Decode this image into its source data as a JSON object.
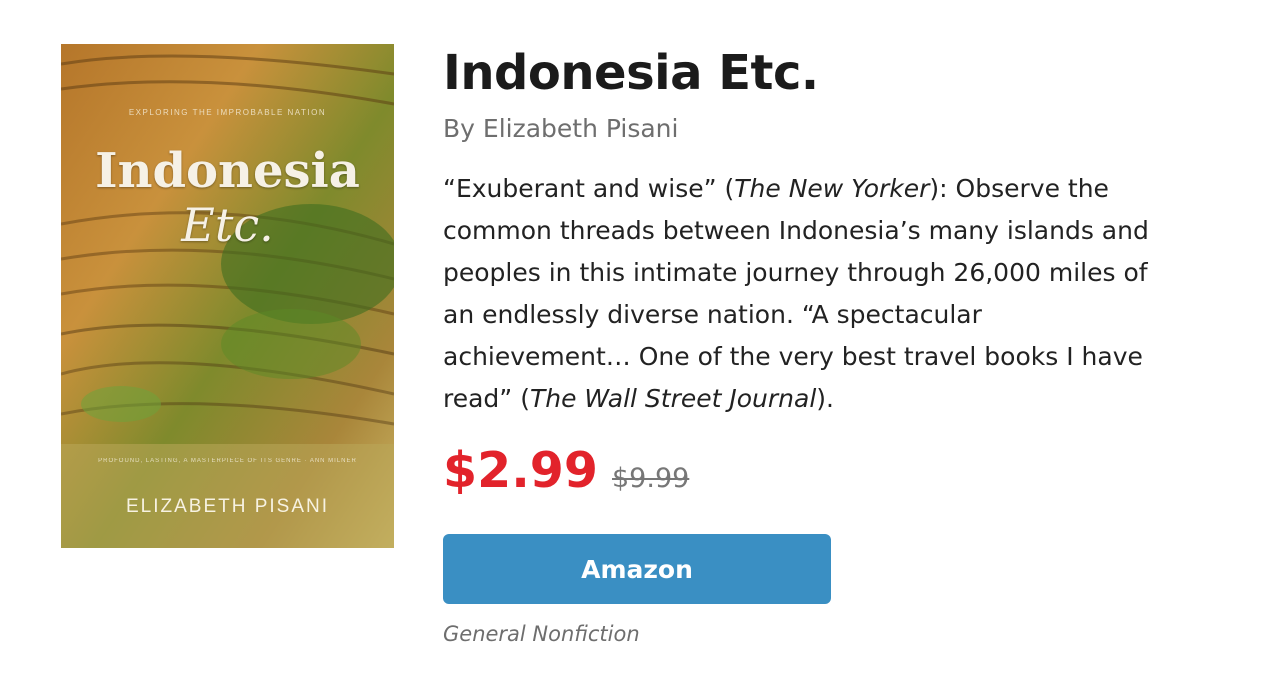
{
  "book": {
    "cover": {
      "tagline": "EXPLORING THE IMPROBABLE NATION",
      "title_line1": "Indonesia",
      "title_line2": "Etc.",
      "blurb": "PROFOUND, LASTING, A MASTERPIECE OF ITS GENRE · ANN MILNER",
      "author": "ELIZABETH PISANI"
    },
    "title": "Indonesia Etc.",
    "author": "By Elizabeth Pisani",
    "description": {
      "l1_a": "“Exuberant and wise” (",
      "l1_em": "The New Yorker",
      "l1_b": "): Observe the",
      "l2": "common threads between Indonesia’s many islands and",
      "l3": "peoples in this intimate journey through 26,000 miles of",
      "l4": "an endlessly diverse nation. “A spectacular",
      "l5": "achievement… One of the very best travel books I have",
      "l6_a": "read” (",
      "l6_em": "The Wall Street Journal",
      "l6_b": ")."
    },
    "price": "$2.99",
    "original_price": "$9.99",
    "buy_button_label": "Amazon",
    "genre": "General Nonfiction"
  },
  "colors": {
    "price": "#e2232b",
    "button": "#3a8fc3",
    "muted_text": "#6e6e6e"
  }
}
